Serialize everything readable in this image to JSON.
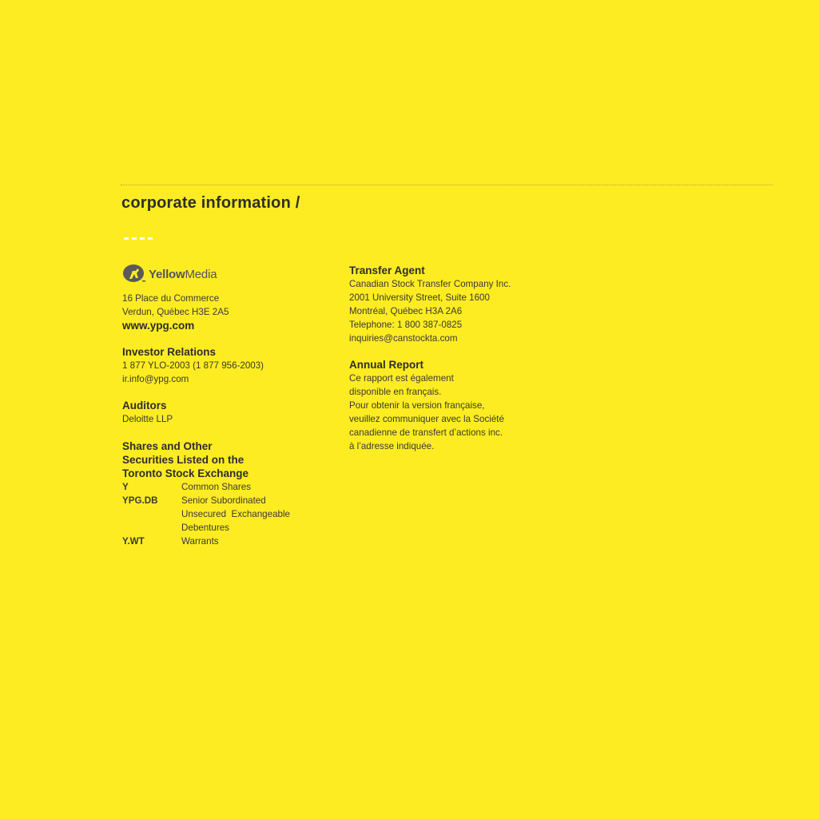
{
  "page": {
    "title": "corporate information /"
  },
  "company": {
    "logo_bold": "Yellow",
    "logo_regular": "Media",
    "address_1": "16 Place du Commerce",
    "address_2": "Verdun, Québec H3E 2A5",
    "website": "www.ypg.com"
  },
  "investor_relations": {
    "heading": "Investor Relations",
    "phone": "1 877 YLO-2003 (1 877 956-2003)",
    "email": "ir.info@ypg.com"
  },
  "auditors": {
    "heading": "Auditors",
    "name": "Deloitte LLP"
  },
  "shares": {
    "heading_line_1": "Shares and Other",
    "heading_line_2": "Securities Listed on the",
    "heading_line_3": "Toronto Stock Exchange",
    "rows": [
      {
        "symbol": "Y",
        "description": [
          "Common Shares"
        ]
      },
      {
        "symbol": "YPG.DB",
        "description": [
          "Senior Subordinated",
          "Unsecured  Exchangeable",
          "Debentures"
        ]
      },
      {
        "symbol": "Y.WT",
        "description": [
          "Warrants"
        ]
      }
    ]
  },
  "transfer_agent": {
    "heading": "Transfer Agent",
    "lines": [
      "Canadian Stock Transfer Company Inc.",
      "2001 University Street, Suite 1600",
      "Montréal, Québec H3A 2A6",
      "Telephone: 1 800 387-0825",
      "inquiries@canstockta.com"
    ]
  },
  "annual_report": {
    "heading": "Annual Report",
    "lines": [
      "Ce rapport est également",
      "disponible en français.",
      "Pour obtenir la version française,",
      "veuillez communiquer avec la Société",
      "canadienne de transfert d’actions inc.",
      "à l’adresse indiquée."
    ]
  },
  "colors": {
    "background": "#fdec22",
    "text": "#3a3a32",
    "accent_dashes": "#ffffff"
  }
}
